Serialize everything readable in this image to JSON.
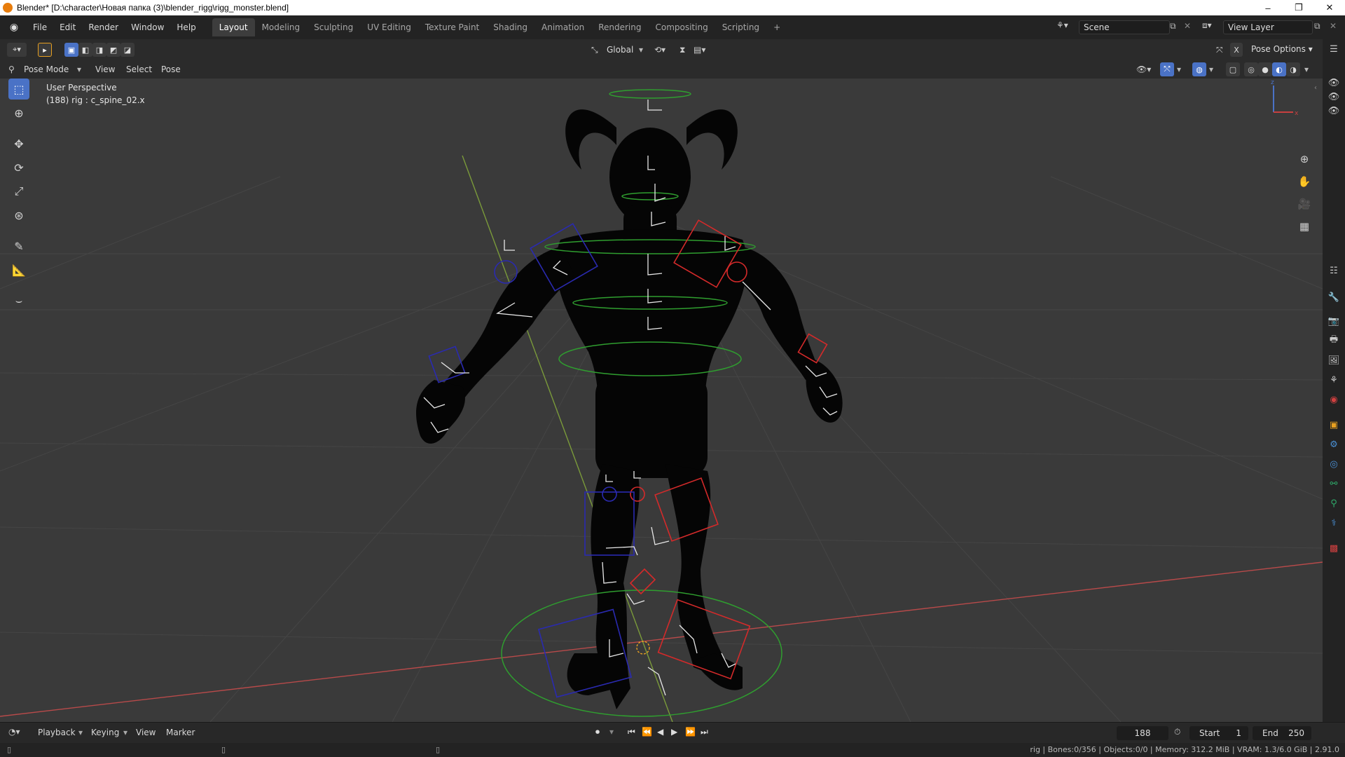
{
  "window": {
    "title": "Blender* [D:\\character\\Новая папка (3)\\blender_rigg\\rigg_monster.blend]",
    "controls": [
      "–",
      "❐",
      "✕"
    ]
  },
  "menu": [
    "File",
    "Edit",
    "Render",
    "Window",
    "Help"
  ],
  "workspaces": [
    "Layout",
    "Modeling",
    "Sculpting",
    "UV Editing",
    "Texture Paint",
    "Shading",
    "Animation",
    "Rendering",
    "Compositing",
    "Scripting"
  ],
  "workspace_add": "+",
  "scene": {
    "label": "Scene"
  },
  "view_layer": {
    "label": "View Layer"
  },
  "viewport_header": {
    "transform_orientation": "Global",
    "pose_options": "Pose Options",
    "mode": "Pose Mode",
    "menus": [
      "View",
      "Select",
      "Pose"
    ]
  },
  "viewport_overlay_text": {
    "perspective": "User Perspective",
    "active": "(188) rig : c_spine_02.x"
  },
  "timeline": {
    "menus": [
      "Playback",
      "Keying",
      "View",
      "Marker"
    ],
    "current_frame": "188",
    "start_label": "Start",
    "start_value": "1",
    "end_label": "End",
    "end_value": "250"
  },
  "statusbar": {
    "stats": "rig | Bones:0/356 | Objects:0/0 | Memory: 312.2 MiB | VRAM: 1.3/6.0 GiB | 2.91.0"
  },
  "gizmo": {
    "axis_x": "x",
    "axis_z": "z"
  },
  "colors": {
    "accent_blue": "#4a72c6",
    "rig_red": "#d42a2a",
    "rig_blue": "#2a2ab0",
    "rig_green": "#2f9e2f",
    "axis_x_line": "#b84a4a",
    "axis_y_line": "#7a9a3a"
  },
  "icons": {
    "tools": [
      "select-box-icon",
      "cursor-icon",
      "move-icon",
      "rotate-icon",
      "scale-icon",
      "transform-icon",
      "annotate-icon",
      "measure-icon",
      "pose-relax-icon"
    ],
    "nav": [
      "zoom-icon",
      "pan-hand-icon",
      "camera-icon",
      "grid-icon"
    ],
    "properties": [
      "tool-icon",
      "render-icon",
      "output-icon",
      "view-layer-icon",
      "scene-icon",
      "world-icon",
      "object-icon",
      "modifier-icon",
      "physics-icon",
      "constraints-icon",
      "object-data-icon",
      "bone-icon",
      "bone-constraint-icon",
      "texture-icon"
    ]
  }
}
